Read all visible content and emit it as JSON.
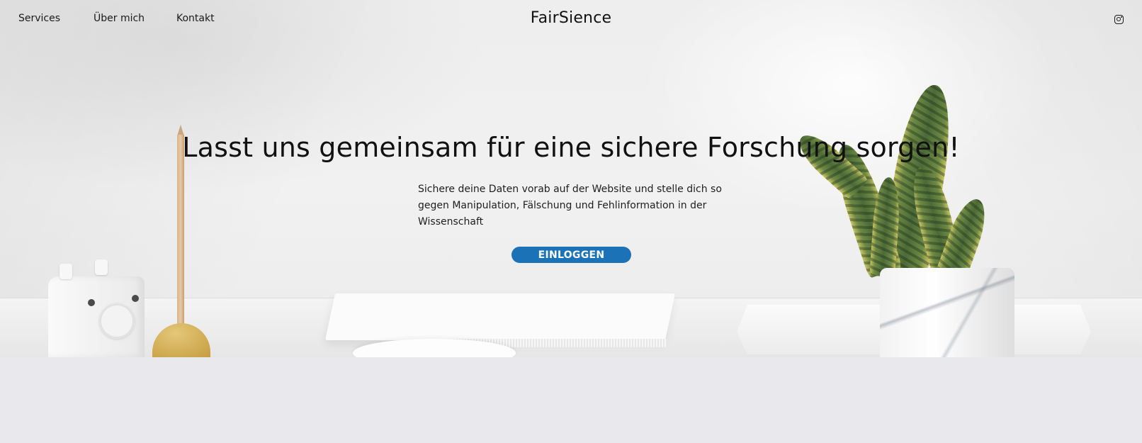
{
  "header": {
    "nav": [
      {
        "label": "Services"
      },
      {
        "label": "Über mich"
      },
      {
        "label": "Kontakt"
      }
    ],
    "brand": "FairSience",
    "social_icon": "instagram-icon"
  },
  "hero": {
    "headline": "Lasst uns gemeinsam für eine sichere Forschung sorgen!",
    "subtext": "Sichere deine Daten vorab auf der Website und stelle dich so gegen Manipulation, Fälschung und Fehlinformation in der Wissenschaft",
    "cta_label": "EINLOGGEN"
  },
  "colors": {
    "accent": "#1b72b6",
    "page_background": "#e9e9ed",
    "text": "#111111"
  }
}
